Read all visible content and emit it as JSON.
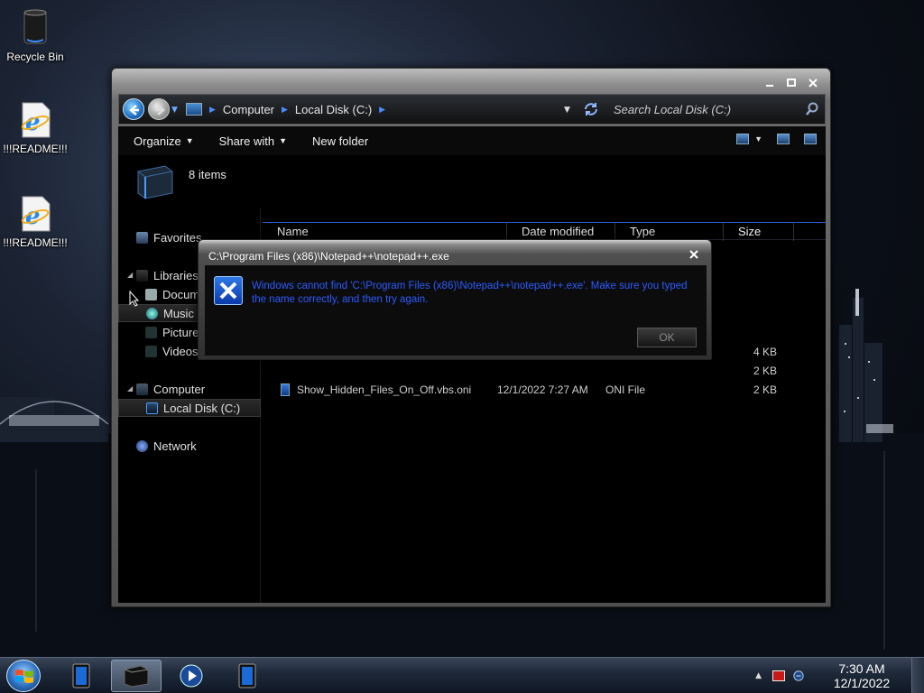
{
  "desktop": {
    "icons": [
      {
        "label": "Recycle Bin",
        "icon": "recycle-bin-icon"
      },
      {
        "label": "!!!README!!!",
        "icon": "internet-explorer-icon"
      },
      {
        "label": "!!!README!!!",
        "icon": "internet-explorer-icon"
      }
    ]
  },
  "explorer": {
    "breadcrumb": [
      "Computer",
      "Local Disk (C:)"
    ],
    "search_placeholder": "Search Local Disk (C:)",
    "toolbar": {
      "organize": "Organize",
      "share_with": "Share with",
      "new_folder": "New folder"
    },
    "item_count": "8 items",
    "nav": {
      "favorites": "Favorites",
      "libraries": "Libraries",
      "documents": "Docum",
      "music": "Music",
      "pictures": "Picture",
      "videos": "Videos",
      "computer": "Computer",
      "local_disk": "Local Disk (C:)",
      "network": "Network"
    },
    "columns": [
      "Name",
      "Date modified",
      "Type",
      "Size"
    ],
    "rows": [
      {
        "name": "",
        "date": "",
        "type": "",
        "size": "4 KB"
      },
      {
        "name": "",
        "date": "",
        "type": "",
        "size": "2 KB"
      },
      {
        "name": "Show_Hidden_Files_On_Off.vbs.oni",
        "date": "12/1/2022 7:27 AM",
        "type": "ONI File",
        "size": "2 KB"
      }
    ]
  },
  "dialog": {
    "title": "C:\\Program Files (x86)\\Notepad++\\notepad++.exe",
    "message": "Windows cannot find 'C:\\Program Files (x86)\\Notepad++\\notepad++.exe'. Make sure you typed the name correctly, and then try again.",
    "ok_label": "OK"
  },
  "taskbar": {
    "clock_time": "7:30 AM",
    "clock_date": "12/1/2022"
  },
  "colors": {
    "accent": "#2a5cff",
    "window_frame": "#6f6f6f",
    "content_bg": "#000000"
  }
}
